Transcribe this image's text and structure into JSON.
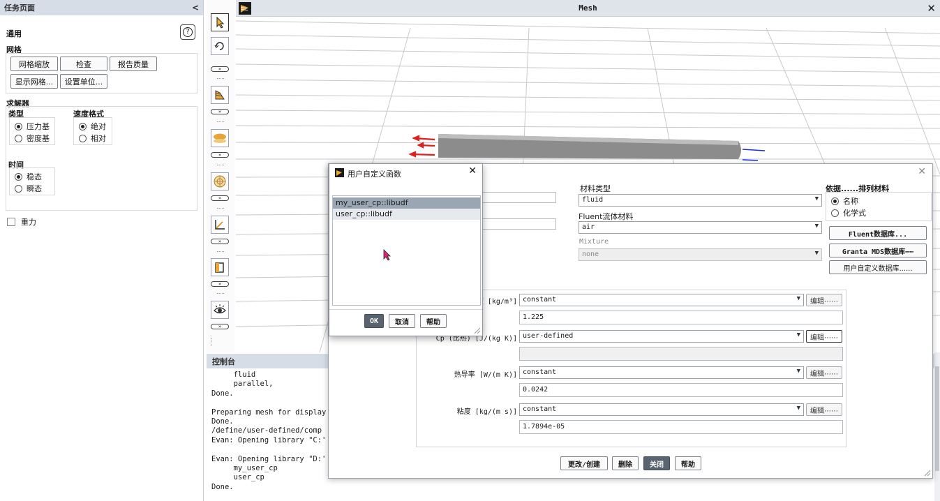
{
  "task_page": {
    "header": "任务页面",
    "collapse": "<",
    "section_general": "通用",
    "help_icon": "?",
    "mesh_group": "网格",
    "mesh_buttons": [
      "网格缩放",
      "检查",
      "报告质量",
      "显示网格...",
      "设置单位..."
    ],
    "solver_group": "求解器",
    "type_label": "类型",
    "type_options": [
      "压力基",
      "密度基"
    ],
    "velocity_label": "速度格式",
    "velocity_options": [
      "绝对",
      "相对"
    ],
    "time_label": "时间",
    "time_options": [
      "稳态",
      "瞬态"
    ],
    "gravity_label": "重力"
  },
  "mesh_window": {
    "title": "Mesh",
    "close": "✕"
  },
  "console": {
    "header": "控制台",
    "lines": "     fluid\n     parallel,\nDone.\n\nPreparing mesh for display\nDone.\n/define/user-defined/comp\nEvan: Opening library \"C:'\n\nEvan: Opening library \"D:'\n     my_user_cp\n     user_cp\nDone."
  },
  "materials_dialog": {
    "close": "✕",
    "material_type_label": "材料类型",
    "material_type_value": "fluid",
    "fluent_material_label": "Fluent流体材料",
    "fluent_material_value": "air",
    "mixture_label": "Mixture",
    "mixture_value": "none",
    "sort_label": "依据......排列材料",
    "sort_options": [
      "名称",
      "化学式"
    ],
    "db_buttons": [
      "Fluent数据库...",
      "Granta MDS数据库⋯⋯",
      "用户自定义数据库......"
    ],
    "properties": [
      {
        "label": "度 [kg/m³]",
        "method": "constant",
        "value": "1.225",
        "edit": "编辑⋯⋯"
      },
      {
        "label": "Cp (比热) [J/(kg K)]",
        "method": "user-defined",
        "value": "",
        "edit": "编辑⋯⋯"
      },
      {
        "label": "热导率 [W/(m K)]",
        "method": "constant",
        "value": "0.0242",
        "edit": "编辑⋯⋯"
      },
      {
        "label": "粘度 [kg/(m s)]",
        "method": "constant",
        "value": "1.7894e-05",
        "edit": "编辑⋯⋯"
      }
    ],
    "footer_buttons": [
      "更改/创建",
      "删除",
      "关闭",
      "帮助"
    ]
  },
  "udf_dialog": {
    "title": "用户自定义函数",
    "close": "✕",
    "items": [
      "my_user_cp::libudf",
      "user_cp::libudf"
    ],
    "buttons": [
      "OK",
      "取消",
      "帮助"
    ]
  }
}
